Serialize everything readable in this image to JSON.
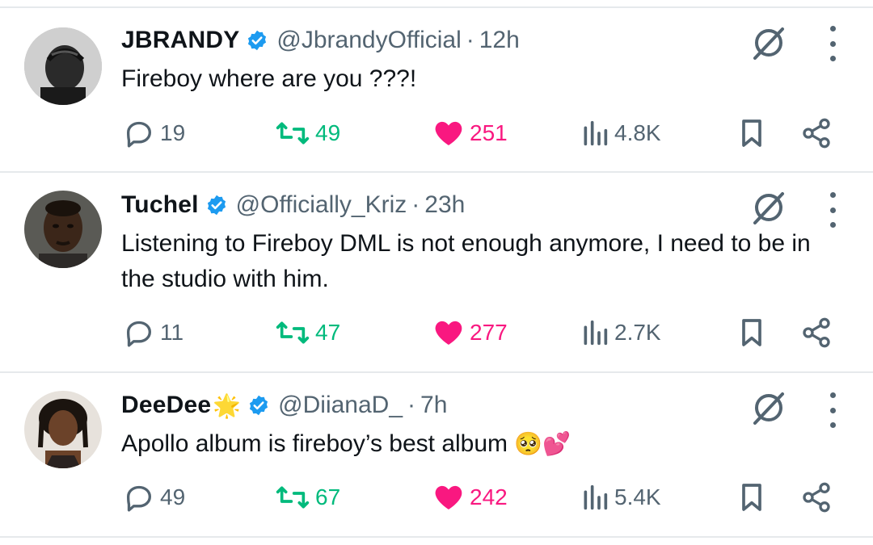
{
  "tweets": [
    {
      "name": "JBRANDY",
      "name_emoji": "",
      "handle": "@JbrandyOfficial",
      "separator": "·",
      "time": "12h",
      "text": "Fireboy where are you ???!",
      "text_emoji": "",
      "replies": "19",
      "retweets": "49",
      "likes": "251",
      "views": "4.8K"
    },
    {
      "name": "Tuchel",
      "name_emoji": "",
      "handle": "@Officially_Kriz",
      "separator": "·",
      "time": "23h",
      "text": "Listening to Fireboy DML is not enough anymore, I need to be in the studio with him.",
      "text_emoji": "",
      "replies": "11",
      "retweets": "47",
      "likes": "277",
      "views": "2.7K"
    },
    {
      "name": "DeeDee",
      "name_emoji": "🌟",
      "handle": "@DiianaD_",
      "separator": "·",
      "time": "7h",
      "text": "Apollo album is fireboy’s best album",
      "text_emoji": "🥺💕",
      "replies": "49",
      "retweets": "67",
      "likes": "242",
      "views": "5.4K"
    }
  ],
  "colors": {
    "text": "#0f1419",
    "secondary": "#536471",
    "verified": "#1d9bf0",
    "retweet": "#00ba7c",
    "like": "#f91880",
    "divider": "#e6e9ec"
  },
  "icons": [
    "verified-badge-icon",
    "grok-icon",
    "more-icon",
    "reply-icon",
    "retweet-icon",
    "heart-icon",
    "views-icon",
    "bookmark-icon",
    "share-icon"
  ]
}
